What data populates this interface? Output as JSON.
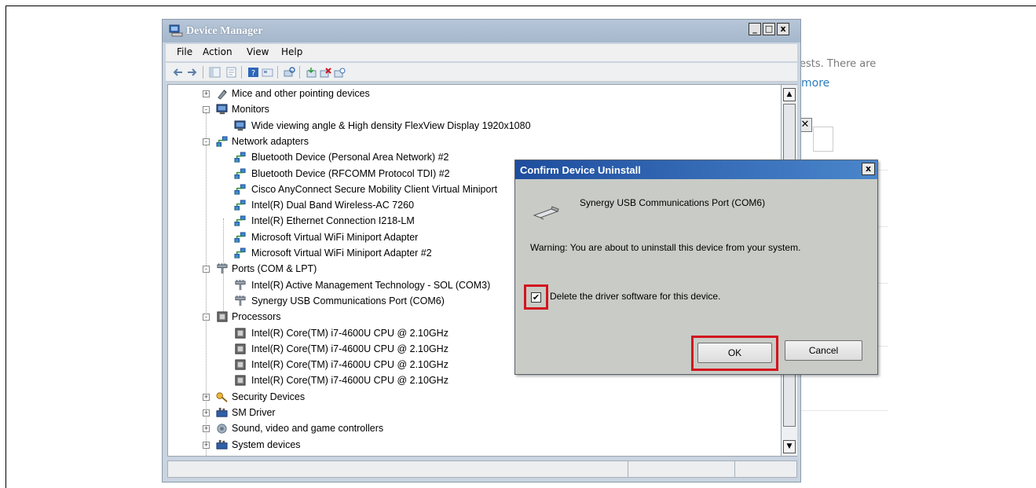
{
  "background": {
    "snippet_text": "ests. There are",
    "more_link": "more"
  },
  "window": {
    "title": "Device Manager",
    "controls": {
      "minimize": "_",
      "maximize": "□",
      "close": "x"
    },
    "menu": [
      "File",
      "Action",
      "View",
      "Help"
    ]
  },
  "tree": [
    {
      "label": "Mice and other pointing devices",
      "level": 0,
      "expand": "+",
      "icon": "mouse-icon"
    },
    {
      "label": "Monitors",
      "level": 0,
      "expand": "-",
      "icon": "monitor-icon"
    },
    {
      "label": "Wide viewing angle & High density FlexView Display 1920x1080",
      "level": 1,
      "icon": "monitor-icon"
    },
    {
      "label": "Network adapters",
      "level": 0,
      "expand": "-",
      "icon": "network-icon"
    },
    {
      "label": "Bluetooth Device (Personal Area Network) #2",
      "level": 1,
      "icon": "network-icon"
    },
    {
      "label": "Bluetooth Device (RFCOMM Protocol TDI) #2",
      "level": 1,
      "icon": "network-icon"
    },
    {
      "label": "Cisco AnyConnect Secure Mobility Client Virtual Miniport",
      "level": 1,
      "icon": "network-icon"
    },
    {
      "label": "Intel(R) Dual Band Wireless-AC 7260",
      "level": 1,
      "icon": "network-icon"
    },
    {
      "label": "Intel(R) Ethernet Connection I218-LM",
      "level": 1,
      "icon": "network-icon"
    },
    {
      "label": "Microsoft Virtual WiFi Miniport Adapter",
      "level": 1,
      "icon": "network-icon"
    },
    {
      "label": "Microsoft Virtual WiFi Miniport Adapter #2",
      "level": 1,
      "icon": "network-icon"
    },
    {
      "label": "Ports (COM & LPT)",
      "level": 0,
      "expand": "-",
      "icon": "port-icon"
    },
    {
      "label": "Intel(R) Active Management Technology - SOL (COM3)",
      "level": 1,
      "icon": "port-icon"
    },
    {
      "label": "Synergy USB Communications Port (COM6)",
      "level": 1,
      "icon": "port-icon"
    },
    {
      "label": "Processors",
      "level": 0,
      "expand": "-",
      "icon": "processor-icon"
    },
    {
      "label": "Intel(R) Core(TM) i7-4600U CPU @ 2.10GHz",
      "level": 1,
      "icon": "processor-icon"
    },
    {
      "label": "Intel(R) Core(TM) i7-4600U CPU @ 2.10GHz",
      "level": 1,
      "icon": "processor-icon"
    },
    {
      "label": "Intel(R) Core(TM) i7-4600U CPU @ 2.10GHz",
      "level": 1,
      "icon": "processor-icon"
    },
    {
      "label": "Intel(R) Core(TM) i7-4600U CPU @ 2.10GHz",
      "level": 1,
      "icon": "processor-icon"
    },
    {
      "label": "Security Devices",
      "level": 0,
      "expand": "+",
      "icon": "key-icon"
    },
    {
      "label": "SM Driver",
      "level": 0,
      "expand": "+",
      "icon": "driver-icon"
    },
    {
      "label": "Sound, video and game controllers",
      "level": 0,
      "expand": "+",
      "icon": "speaker-icon"
    },
    {
      "label": "System devices",
      "level": 0,
      "expand": "+",
      "icon": "driver-icon"
    }
  ],
  "dialog": {
    "title": "Confirm Device Uninstall",
    "close": "x",
    "device_name": "Synergy USB Communications Port (COM6)",
    "warning": "Warning: You are about to uninstall this device from your system.",
    "checkbox_label": "Delete the driver software for this device.",
    "checkbox_checked": true,
    "ok_label": "OK",
    "cancel_label": "Cancel"
  },
  "colors": {
    "highlight": "#d2141e",
    "dialog_title_bar": "#1e4d9e",
    "window_chrome": "#c9d4e0"
  }
}
